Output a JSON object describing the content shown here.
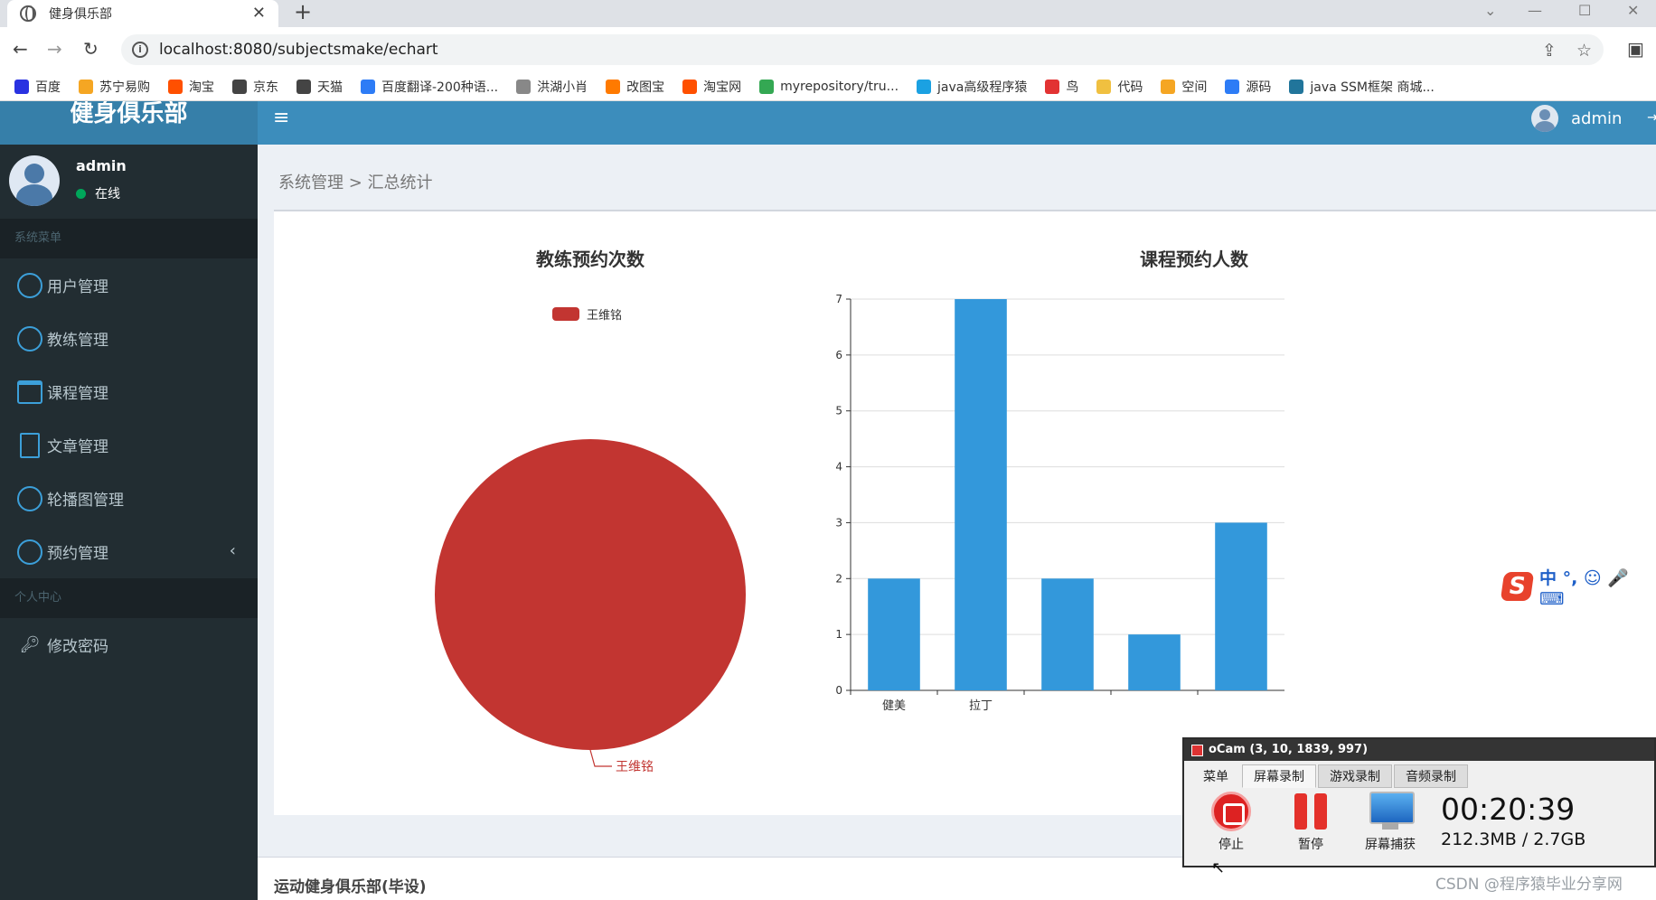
{
  "browser": {
    "tab_title": "健身俱乐部",
    "url": "localhost:8080/subjectsmake/echart",
    "bookmarks": [
      {
        "label": "百度",
        "color": "#2932e1"
      },
      {
        "label": "苏宁易购",
        "color": "#f5a623"
      },
      {
        "label": "淘宝",
        "color": "#ff5000"
      },
      {
        "label": "京东",
        "color": "#444444"
      },
      {
        "label": "天猫",
        "color": "#444444"
      },
      {
        "label": "百度翻译-200种语...",
        "color": "#2d7cf6"
      },
      {
        "label": "洪湖小肖",
        "color": "#888888"
      },
      {
        "label": "改图宝",
        "color": "#ff7a00"
      },
      {
        "label": "淘宝网",
        "color": "#ff5000"
      },
      {
        "label": "myrepository/tru...",
        "color": "#34a853"
      },
      {
        "label": "java高级程序猿",
        "color": "#1ba1e2"
      },
      {
        "label": "鸟",
        "color": "#e23333"
      },
      {
        "label": "代码",
        "color": "#f0c040"
      },
      {
        "label": "空间",
        "color": "#f5a623"
      },
      {
        "label": "源码",
        "color": "#2d7cf6"
      },
      {
        "label": "java SSM框架 商城...",
        "color": "#21759b"
      }
    ]
  },
  "header": {
    "logo": "健身俱乐部",
    "user": "admin"
  },
  "sidebar": {
    "user_name": "admin",
    "user_status": "在线",
    "section_system": "系统菜单",
    "items": [
      {
        "label": "用户管理",
        "icon": "user-circle-icon"
      },
      {
        "label": "教练管理",
        "icon": "coach-circle-icon"
      },
      {
        "label": "课程管理",
        "icon": "calendar-icon"
      },
      {
        "label": "文章管理",
        "icon": "document-icon"
      },
      {
        "label": "轮播图管理",
        "icon": "image-circle-icon"
      },
      {
        "label": "预约管理",
        "icon": "clock-circle-icon"
      }
    ],
    "section_personal": "个人中心",
    "change_password": "修改密码"
  },
  "content": {
    "breadcrumb_parent": "系统管理",
    "breadcrumb_sep": ">",
    "breadcrumb_current": "汇总统计"
  },
  "chart_data": [
    {
      "type": "pie",
      "title": "教练预约次数",
      "legend": [
        "王维铭"
      ],
      "legend_position": "top-center",
      "slices": [
        {
          "name": "王维铭",
          "value": 1
        }
      ],
      "color": "#c23531"
    },
    {
      "type": "bar",
      "title": "课程预约人数",
      "categories": [
        "健美",
        "拉丁",
        "",
        "",
        ""
      ],
      "values": [
        2,
        7,
        2,
        1,
        3
      ],
      "ylim": [
        0,
        7
      ],
      "yticks": [
        "0",
        "1",
        "2",
        "3",
        "4",
        "5",
        "6",
        "7"
      ],
      "grid": true,
      "color": "#3398db"
    }
  ],
  "footer": {
    "text": "运动健身俱乐部(毕设)"
  },
  "ime": {
    "logo": "S",
    "glyphs": "中 °, ☺ 🎤 ⌨"
  },
  "ocam": {
    "title": "oCam (3, 10, 1839, 997)",
    "tabs": [
      "菜单",
      "屏幕录制",
      "游戏录制",
      "音频录制"
    ],
    "stop": "停止",
    "pause": "暂停",
    "capture": "屏幕捕获",
    "time": "00:20:39",
    "size": "212.3MB / 2.7GB"
  },
  "watermark": "CSDN @程序猿毕业分享网"
}
